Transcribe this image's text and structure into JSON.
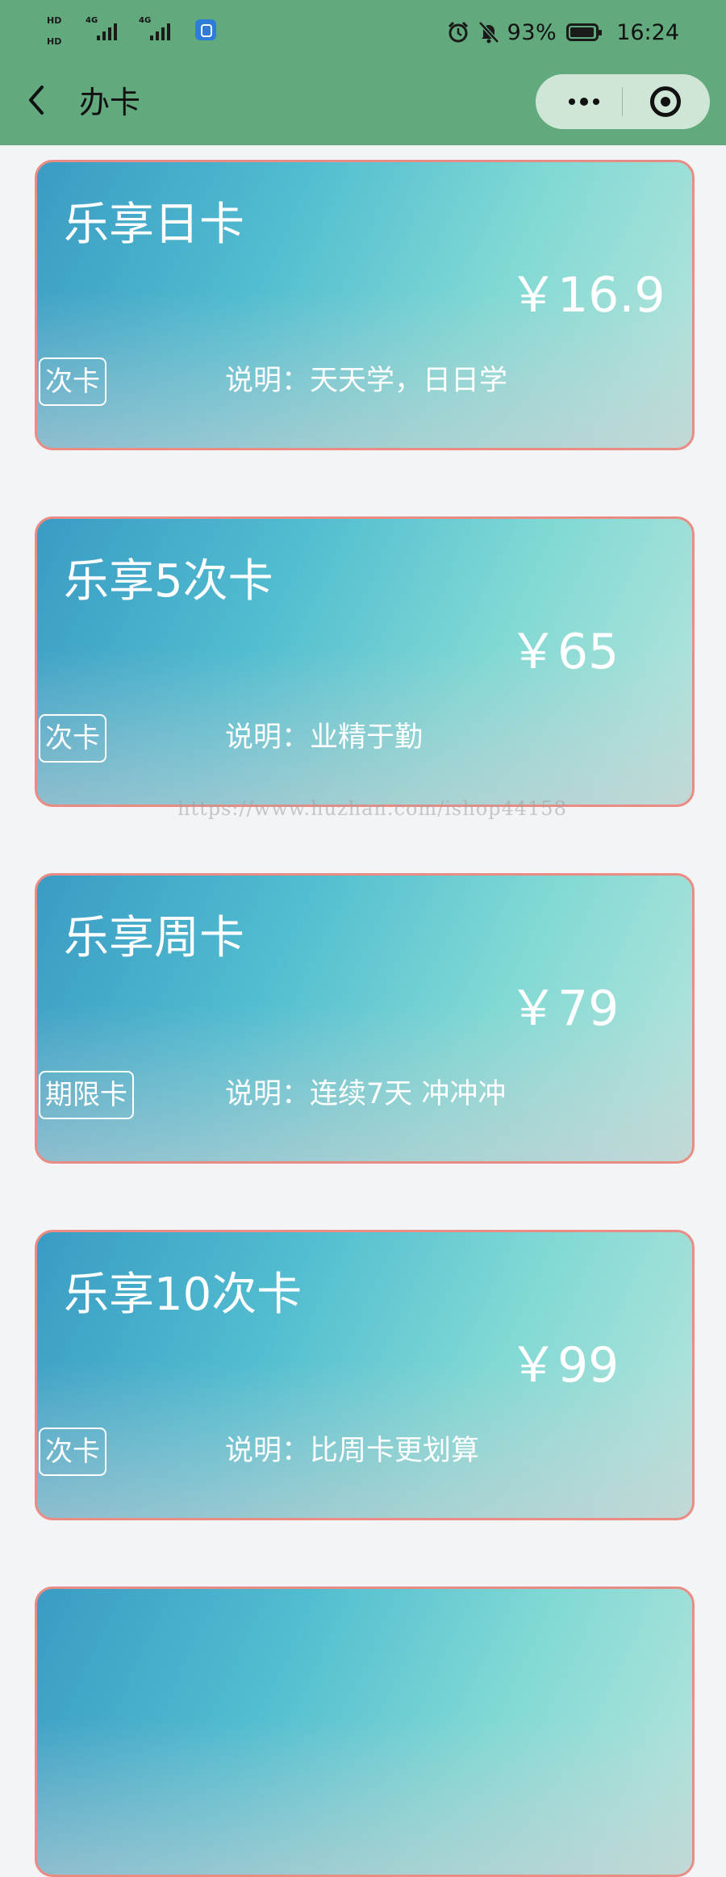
{
  "status_bar": {
    "hd1": "HD",
    "hd2": "HD",
    "signal1_label": "4G",
    "signal2_label": "4G",
    "battery_percent": "93%",
    "time": "16:24"
  },
  "nav": {
    "back_icon": "chevron-left-icon",
    "title": "办卡",
    "more_icon": "more-dots-icon",
    "close_icon": "target-circle-icon"
  },
  "cards": [
    {
      "name": "乐享日卡",
      "price": "￥16.9",
      "tag": "次卡",
      "description": "说明：天天学，日日学"
    },
    {
      "name": "乐享5次卡",
      "price": "￥65",
      "tag": "次卡",
      "description": "说明：业精于勤"
    },
    {
      "name": "乐享周卡",
      "price": "￥79",
      "tag": "期限卡",
      "description": "说明：连续7天 冲冲冲"
    },
    {
      "name": "乐享10次卡",
      "price": "￥99",
      "tag": "次卡",
      "description": "说明：比周卡更划算"
    }
  ],
  "watermark": "https://www.huzhan.com/ishop44158",
  "colors": {
    "nav_background": "#62aa7e",
    "card_border": "#eb8c84",
    "card_gradient_start": "#3a9bc4",
    "card_gradient_end": "#b9e6dc",
    "page_background": "#f3f4f6"
  }
}
